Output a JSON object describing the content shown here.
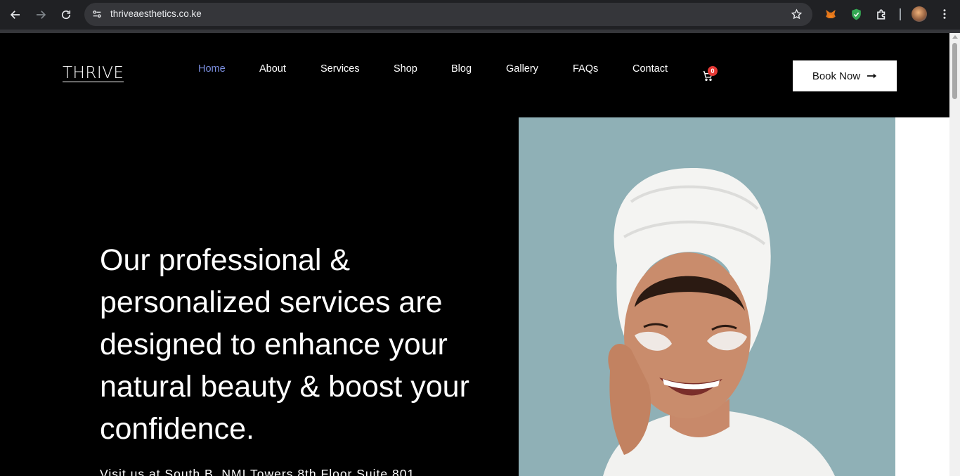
{
  "browser": {
    "url": "thriveaesthetics.co.ke",
    "back_icon": "back-arrow-icon",
    "forward_icon": "forward-arrow-icon",
    "reload_icon": "reload-icon",
    "site_info_icon": "site-settings-icon",
    "bookmark_icon": "star-icon",
    "extensions": [
      "metamask-fox-icon",
      "shield-check-icon",
      "puzzle-extensions-icon"
    ],
    "profile_icon": "profile-avatar",
    "menu_icon": "kebab-menu-icon"
  },
  "site": {
    "logo": "THRIVE",
    "nav": [
      {
        "label": "Home",
        "active": true
      },
      {
        "label": "About",
        "active": false
      },
      {
        "label": "Services",
        "active": false
      },
      {
        "label": "Shop",
        "active": false
      },
      {
        "label": "Blog",
        "active": false
      },
      {
        "label": "Gallery",
        "active": false
      },
      {
        "label": "FAQs",
        "active": false
      },
      {
        "label": "Contact",
        "active": false
      }
    ],
    "cart_count": "0",
    "book_button": "Book Now",
    "accent_color": "#7b8fe0"
  },
  "hero": {
    "headline": "Our professional & personalized services are designed to enhance your natural beauty & boost your confidence.",
    "visit_text": "Visit us at South B, NMI Towers 8th Floor Suite 801"
  }
}
